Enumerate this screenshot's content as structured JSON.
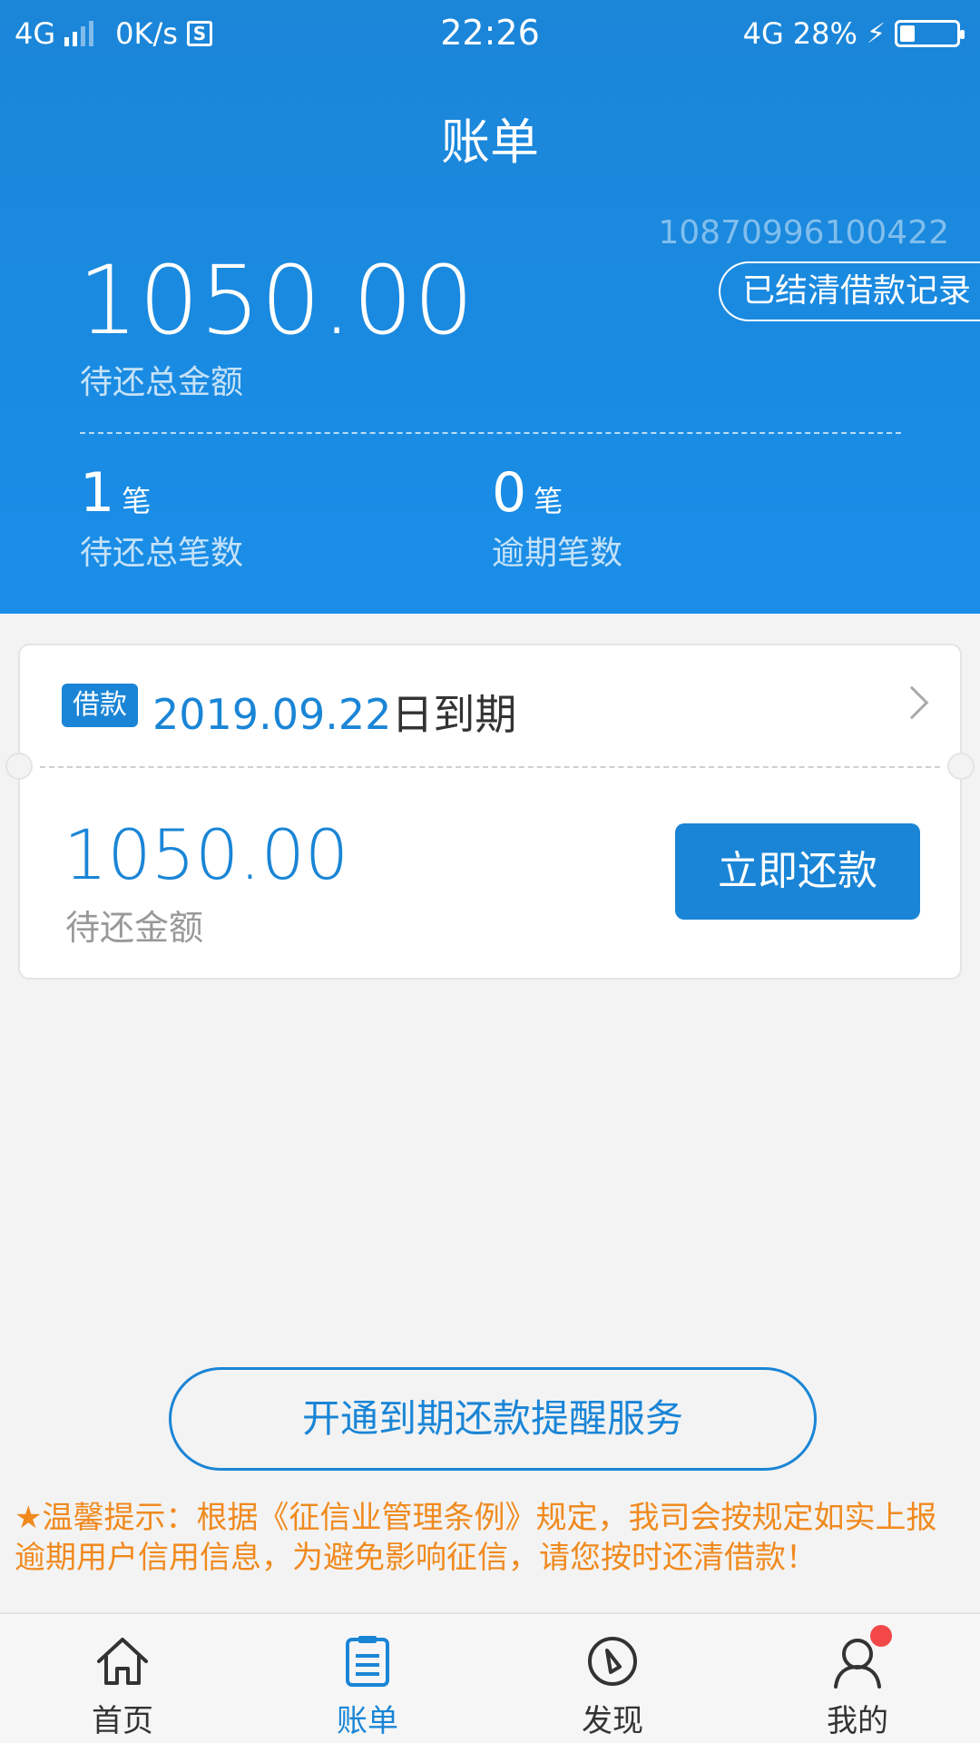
{
  "status_bar": {
    "network_left": "4G",
    "speed": "0K/s",
    "sim_icon_label": "S",
    "time": "22:26",
    "network_right": "4G",
    "battery_percent": "28%"
  },
  "header": {
    "title": "账单",
    "account_number": "10870996100422",
    "settled_records_label": "已结清借款记录",
    "total_amount": "1050.00",
    "total_amount_label": "待还总金额",
    "pending_count": "1",
    "pending_unit": "笔",
    "pending_label": "待还总笔数",
    "overdue_count": "0",
    "overdue_unit": "笔",
    "overdue_label": "逾期笔数"
  },
  "loan_card": {
    "tag": "借款",
    "due_date": "2019.09.22",
    "due_suffix": "日到期",
    "amount": "1050.00",
    "amount_label": "待还金额",
    "pay_button": "立即还款"
  },
  "reminder_button": "开通到期还款提醒服务",
  "tip": "★温馨提示：根据《征信业管理条例》规定，我司会按规定如实上报逾期用户信用信息，为避免影响征信，请您按时还清借款！",
  "bottom_nav": [
    {
      "label": "首页",
      "icon": "home-icon"
    },
    {
      "label": "账单",
      "icon": "bill-icon"
    },
    {
      "label": "发现",
      "icon": "compass-icon"
    },
    {
      "label": "我的",
      "icon": "user-icon"
    }
  ],
  "colors": {
    "brand": "#1a85d6",
    "tip": "#f08a1f",
    "badge": "#f24848"
  }
}
